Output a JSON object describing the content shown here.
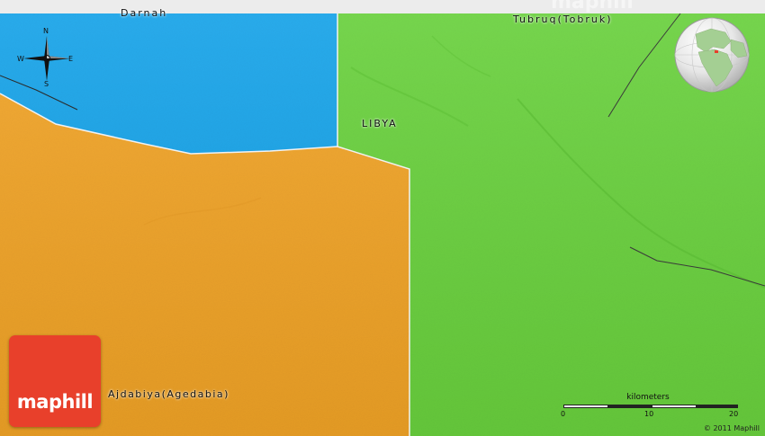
{
  "map": {
    "watermark": "maphill",
    "regions": [
      {
        "id": "darnah",
        "color": "#1ea6ec"
      },
      {
        "id": "libya-east",
        "color": "#6cd43f"
      },
      {
        "id": "ajdabiya",
        "color": "#f4a62a"
      }
    ],
    "labels": {
      "darnah": "Darnah",
      "tubruq": "Tubruq(Tobruk)",
      "libya": "LIBYA",
      "ajdabiya": "Ajdabiya(Agedabia)"
    },
    "compass": {
      "n": "N",
      "s": "S",
      "e": "E",
      "w": "W"
    },
    "scale": {
      "unit": "kilometers",
      "ticks": [
        "0",
        "10",
        "20"
      ]
    },
    "copyright": "© 2011 Maphill",
    "logo": "maphill",
    "colors": {
      "border": "#f2f2f2",
      "logo_bg": "#e8402b",
      "road": "#3a3a3a"
    }
  }
}
